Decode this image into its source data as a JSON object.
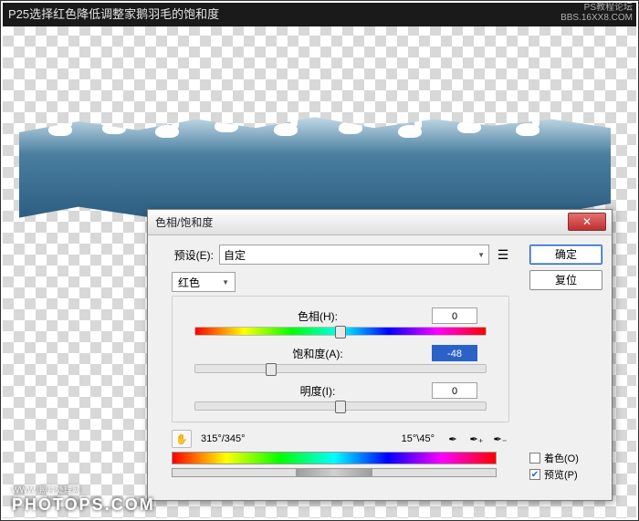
{
  "caption": "P25选择红色降低调整家鹅羽毛的饱和度",
  "watermark_top": {
    "line1": "PS教程论坛",
    "line2": "BBS.16XX8.COM"
  },
  "watermark_bottom": {
    "small": "WWW.  照片处理网",
    "big": "PHOTOPS.COM"
  },
  "dialog": {
    "title": "色相/饱和度",
    "preset_label": "预设(E):",
    "preset_value": "自定",
    "channel": "红色",
    "hue_label": "色相(H):",
    "hue_value": "0",
    "sat_label": "饱和度(A):",
    "sat_value": "-48",
    "light_label": "明度(I):",
    "light_value": "0",
    "range_left": "315°/345°",
    "range_right": "15°\\45°",
    "ok": "确定",
    "cancel": "复位",
    "colorize": "着色(O)",
    "preview": "预览(P)"
  }
}
